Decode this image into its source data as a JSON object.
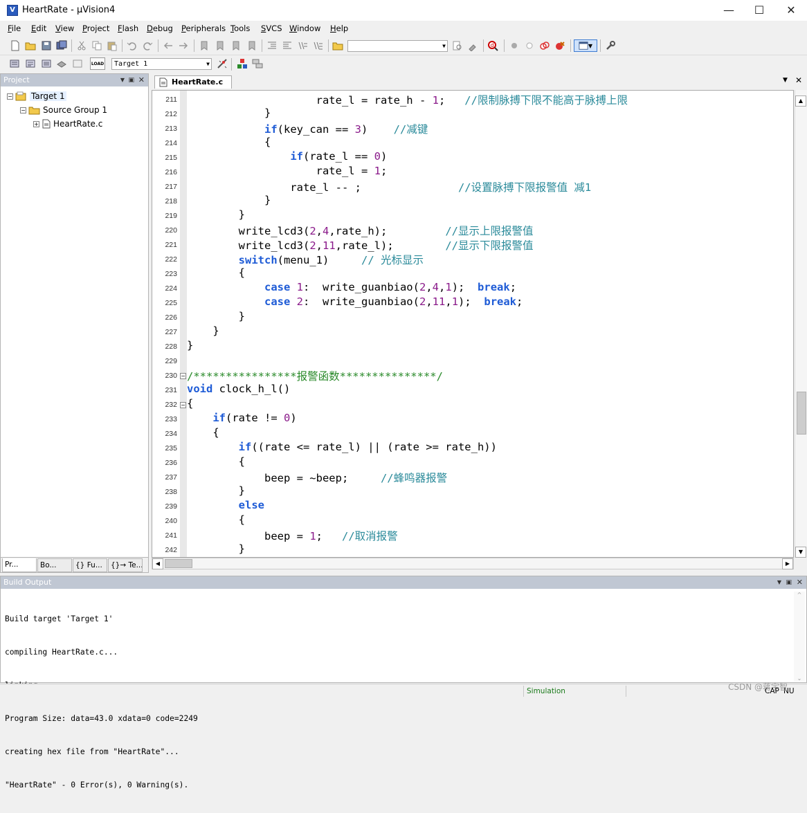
{
  "window": {
    "title": "HeartRate  - µVision4",
    "app_icon_glyph": "V"
  },
  "menu": [
    "File",
    "Edit",
    "View",
    "Project",
    "Flash",
    "Debug",
    "Peripherals",
    "Tools",
    "SVCS",
    "Window",
    "Help"
  ],
  "toolbar": {
    "find_combo_value": "",
    "target_combo_value": "Target 1",
    "load_label": "LOAD"
  },
  "project_panel": {
    "title": "Project",
    "tree": [
      {
        "label": "Target 1",
        "level": 0,
        "icon": "target-icon"
      },
      {
        "label": "Source Group 1",
        "level": 1,
        "icon": "folder-icon"
      },
      {
        "label": "HeartRate.c",
        "level": 2,
        "icon": "file-icon"
      }
    ],
    "tabs": [
      "Pr...",
      "Bo...",
      "{} Fu...",
      "{}→ Te..."
    ]
  },
  "editor": {
    "file_tab": "HeartRate.c",
    "line_numbers": [
      "211",
      "212",
      "213",
      "214",
      "215",
      "216",
      "217",
      "218",
      "219",
      "220",
      "221",
      "222",
      "223",
      "224",
      "225",
      "226",
      "227",
      "228",
      "229",
      "230",
      "231",
      "232",
      "233",
      "234",
      "235",
      "236",
      "237",
      "238",
      "239",
      "240",
      "241",
      "242"
    ],
    "fold_markers": {
      "230": "−",
      "232": "−"
    }
  },
  "code_lines": [
    [
      {
        "t": "                    rate_l = rate_h - "
      },
      {
        "t": "1",
        "c": "num"
      },
      {
        "t": ";   "
      },
      {
        "t": "//限制脉搏下限不能高于脉搏上限",
        "c": "cm-cn"
      }
    ],
    [
      {
        "t": "            }"
      }
    ],
    [
      {
        "t": "            "
      },
      {
        "t": "if",
        "c": "kw"
      },
      {
        "t": "(key_can == "
      },
      {
        "t": "3",
        "c": "num"
      },
      {
        "t": ")    "
      },
      {
        "t": "//减键",
        "c": "cm-cn"
      }
    ],
    [
      {
        "t": "            {"
      }
    ],
    [
      {
        "t": "                "
      },
      {
        "t": "if",
        "c": "kw"
      },
      {
        "t": "(rate_l == "
      },
      {
        "t": "0",
        "c": "num"
      },
      {
        "t": ")"
      }
    ],
    [
      {
        "t": "                    rate_l = "
      },
      {
        "t": "1",
        "c": "num"
      },
      {
        "t": ";"
      }
    ],
    [
      {
        "t": "                rate_l -- ;               "
      },
      {
        "t": "//设置脉搏下限报警值 减1",
        "c": "cm-cn"
      }
    ],
    [
      {
        "t": "            }"
      }
    ],
    [
      {
        "t": "        }"
      }
    ],
    [
      {
        "t": "        write_lcd3("
      },
      {
        "t": "2",
        "c": "num"
      },
      {
        "t": ","
      },
      {
        "t": "4",
        "c": "num"
      },
      {
        "t": ",rate_h);         "
      },
      {
        "t": "//显示上限报警值",
        "c": "cm-cn"
      }
    ],
    [
      {
        "t": "        write_lcd3("
      },
      {
        "t": "2",
        "c": "num"
      },
      {
        "t": ","
      },
      {
        "t": "11",
        "c": "num"
      },
      {
        "t": ",rate_l);        "
      },
      {
        "t": "//显示下限报警值",
        "c": "cm-cn"
      }
    ],
    [
      {
        "t": "        "
      },
      {
        "t": "switch",
        "c": "kw"
      },
      {
        "t": "(menu_1)     "
      },
      {
        "t": "// 光标显示",
        "c": "cm-cn"
      }
    ],
    [
      {
        "t": "        {"
      }
    ],
    [
      {
        "t": "            "
      },
      {
        "t": "case",
        "c": "kw"
      },
      {
        "t": " "
      },
      {
        "t": "1",
        "c": "num"
      },
      {
        "t": ":  write_guanbiao("
      },
      {
        "t": "2",
        "c": "num"
      },
      {
        "t": ","
      },
      {
        "t": "4",
        "c": "num"
      },
      {
        "t": ","
      },
      {
        "t": "1",
        "c": "num"
      },
      {
        "t": ");  "
      },
      {
        "t": "break",
        "c": "kw"
      },
      {
        "t": ";"
      }
    ],
    [
      {
        "t": "            "
      },
      {
        "t": "case",
        "c": "kw"
      },
      {
        "t": " "
      },
      {
        "t": "2",
        "c": "num"
      },
      {
        "t": ":  write_guanbiao("
      },
      {
        "t": "2",
        "c": "num"
      },
      {
        "t": ","
      },
      {
        "t": "11",
        "c": "num"
      },
      {
        "t": ","
      },
      {
        "t": "1",
        "c": "num"
      },
      {
        "t": ");  "
      },
      {
        "t": "break",
        "c": "kw"
      },
      {
        "t": ";"
      }
    ],
    [
      {
        "t": "        }"
      }
    ],
    [
      {
        "t": "    }"
      }
    ],
    [
      {
        "t": "}"
      }
    ],
    [
      {
        "t": ""
      }
    ],
    [
      {
        "t": "/****************报警函数***************/",
        "c": "cm"
      }
    ],
    [
      {
        "t": "void",
        "c": "kw"
      },
      {
        "t": " clock_h_l()"
      }
    ],
    [
      {
        "t": "{"
      }
    ],
    [
      {
        "t": "    "
      },
      {
        "t": "if",
        "c": "kw"
      },
      {
        "t": "(rate != "
      },
      {
        "t": "0",
        "c": "num"
      },
      {
        "t": ")"
      }
    ],
    [
      {
        "t": "    {"
      }
    ],
    [
      {
        "t": "        "
      },
      {
        "t": "if",
        "c": "kw"
      },
      {
        "t": "((rate <= rate_l) || (rate >= rate_h))"
      }
    ],
    [
      {
        "t": "        {"
      }
    ],
    [
      {
        "t": "            beep = ~beep;     "
      },
      {
        "t": "//蜂鸣器报警",
        "c": "cm-cn"
      }
    ],
    [
      {
        "t": "        }"
      }
    ],
    [
      {
        "t": "        "
      },
      {
        "t": "else",
        "c": "kw"
      }
    ],
    [
      {
        "t": "        {"
      }
    ],
    [
      {
        "t": "            beep = "
      },
      {
        "t": "1",
        "c": "num"
      },
      {
        "t": ";   "
      },
      {
        "t": "//取消报警",
        "c": "cm-cn"
      }
    ],
    [
      {
        "t": "        }"
      }
    ]
  ],
  "build_output": {
    "title": "Build Output",
    "lines": [
      "Build target 'Target 1'",
      "compiling HeartRate.c...",
      "linking...",
      "Program Size: data=43.0 xdata=0 code=2249",
      "creating hex file from \"HeartRate\"...",
      "\"HeartRate\" - 0 Error(s), 0 Warning(s)."
    ]
  },
  "status": {
    "mode": "Simulation",
    "cap": "CAP",
    "num": "NU"
  },
  "watermark": "CSDN @蒋宇智",
  "colors": {
    "keyword": "#1e5bd6",
    "number": "#8a1a8a",
    "comment": "#2a8a2a",
    "comment_cn": "#2a8a9a",
    "status_mode": "#1a7a1a"
  }
}
